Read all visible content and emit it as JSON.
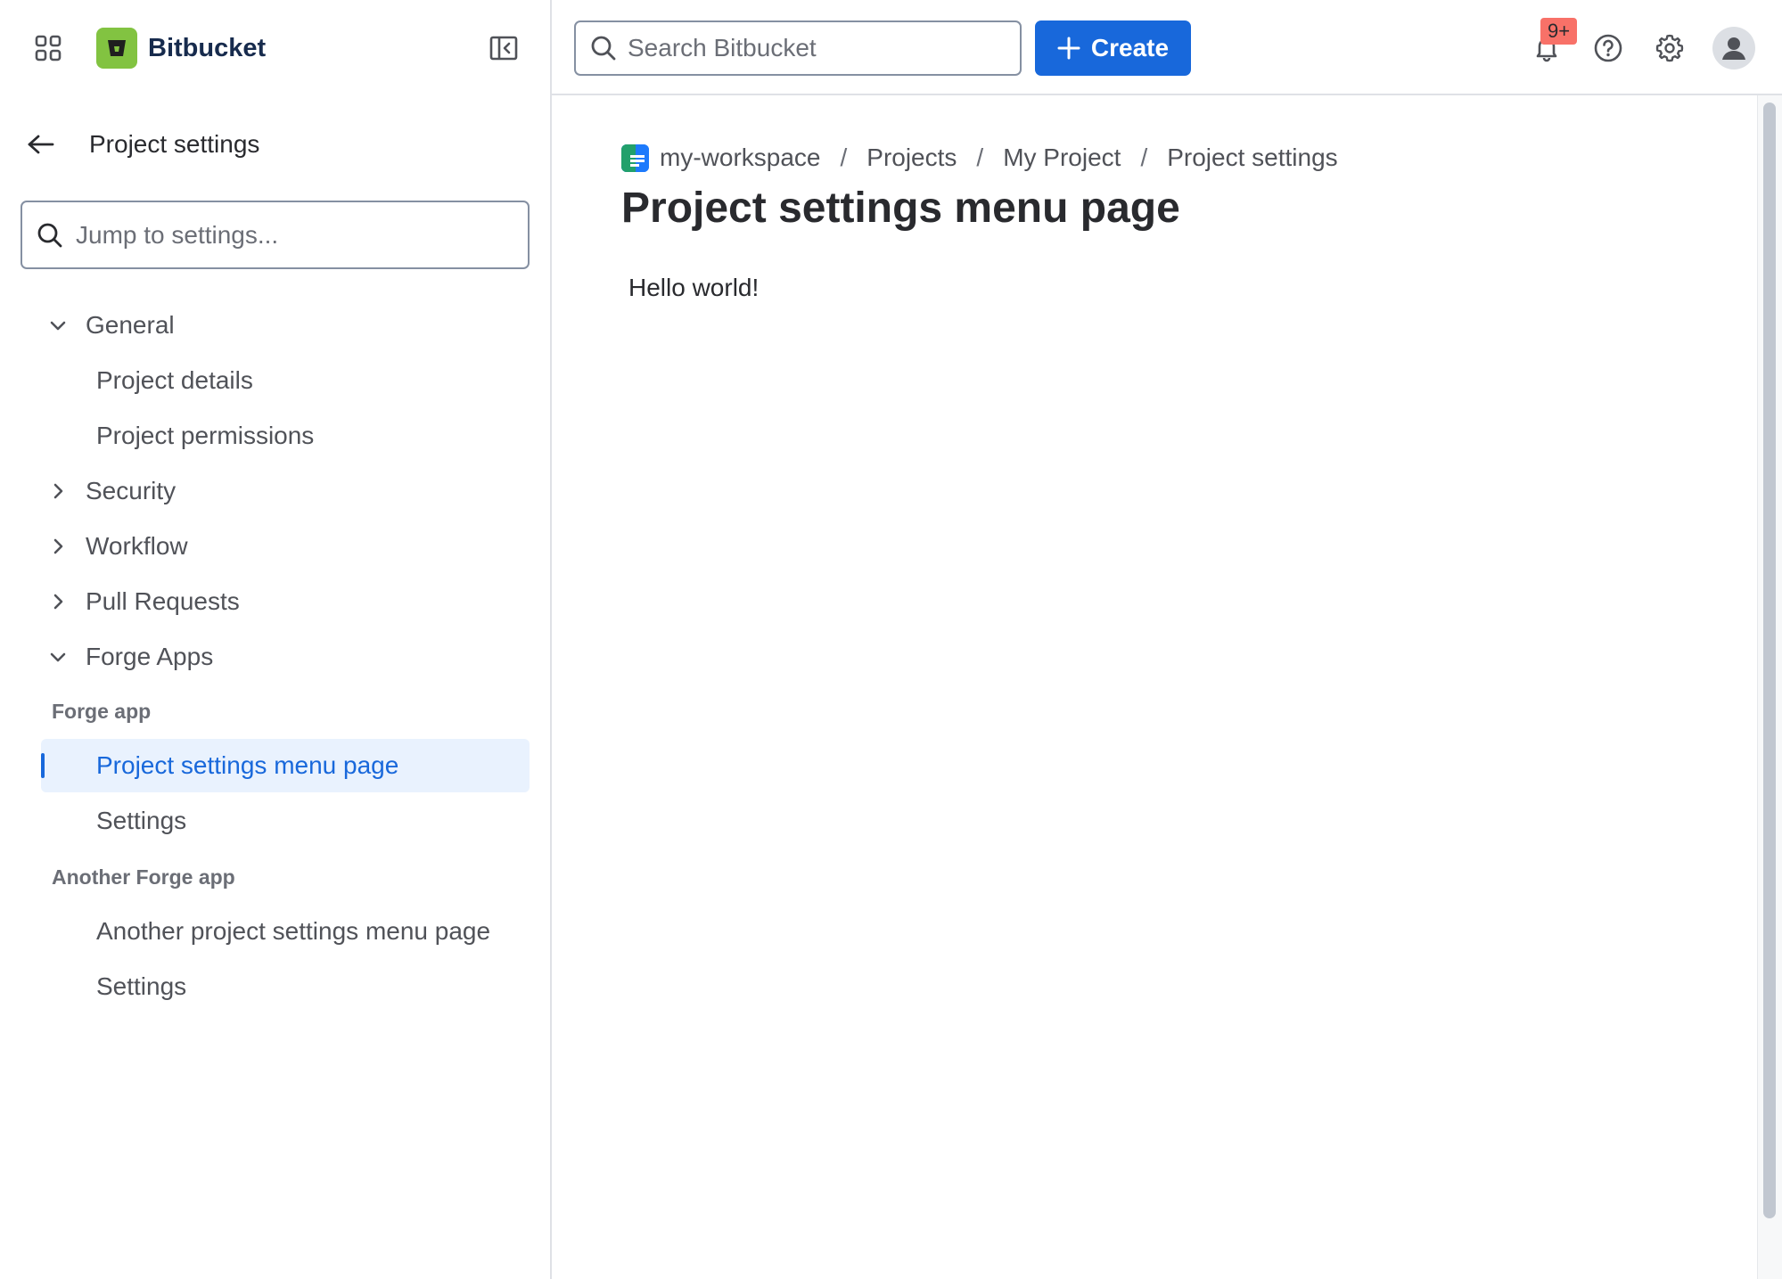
{
  "app": {
    "name": "Bitbucket"
  },
  "sidebar": {
    "back_title": "Project settings",
    "jump_placeholder": "Jump to settings...",
    "sections": [
      {
        "label": "General",
        "expanded": true
      },
      {
        "label": "Security",
        "expanded": false
      },
      {
        "label": "Workflow",
        "expanded": false
      },
      {
        "label": "Pull Requests",
        "expanded": false
      },
      {
        "label": "Forge Apps",
        "expanded": true
      }
    ],
    "general_items": [
      "Project details",
      "Project permissions"
    ],
    "forge_groups": [
      {
        "label": "Forge app",
        "items": [
          "Project settings menu page",
          "Settings"
        ]
      },
      {
        "label": "Another Forge app",
        "items": [
          "Another project settings menu page",
          "Settings"
        ]
      }
    ],
    "selected_item": "Project settings menu page"
  },
  "topbar": {
    "search_placeholder": "Search Bitbucket",
    "create_label": "Create",
    "notification_badge": "9+"
  },
  "main": {
    "breadcrumb": [
      "my-workspace",
      "Projects",
      "My Project",
      "Project settings"
    ],
    "breadcrumb_separator": "/",
    "title": "Project settings menu page",
    "content": "Hello world!"
  },
  "colors": {
    "brand_green": "#82C341",
    "primary_blue": "#1868DB",
    "selected_bg": "#E9F2FE",
    "badge_red": "#F87168",
    "border": "#DFE1E6"
  },
  "icons": {
    "app_switcher": "app-switcher-icon",
    "logo": "bitbucket-logo-icon",
    "collapse": "sidebar-collapse-icon",
    "back": "arrow-left-icon",
    "search": "search-icon",
    "chevron_down": "chevron-down-icon",
    "chevron_right": "chevron-right-icon",
    "plus": "plus-icon",
    "notifications": "bell-icon",
    "help": "help-icon",
    "settings": "gear-icon",
    "avatar": "person-icon",
    "project": "project-avatar-icon"
  }
}
